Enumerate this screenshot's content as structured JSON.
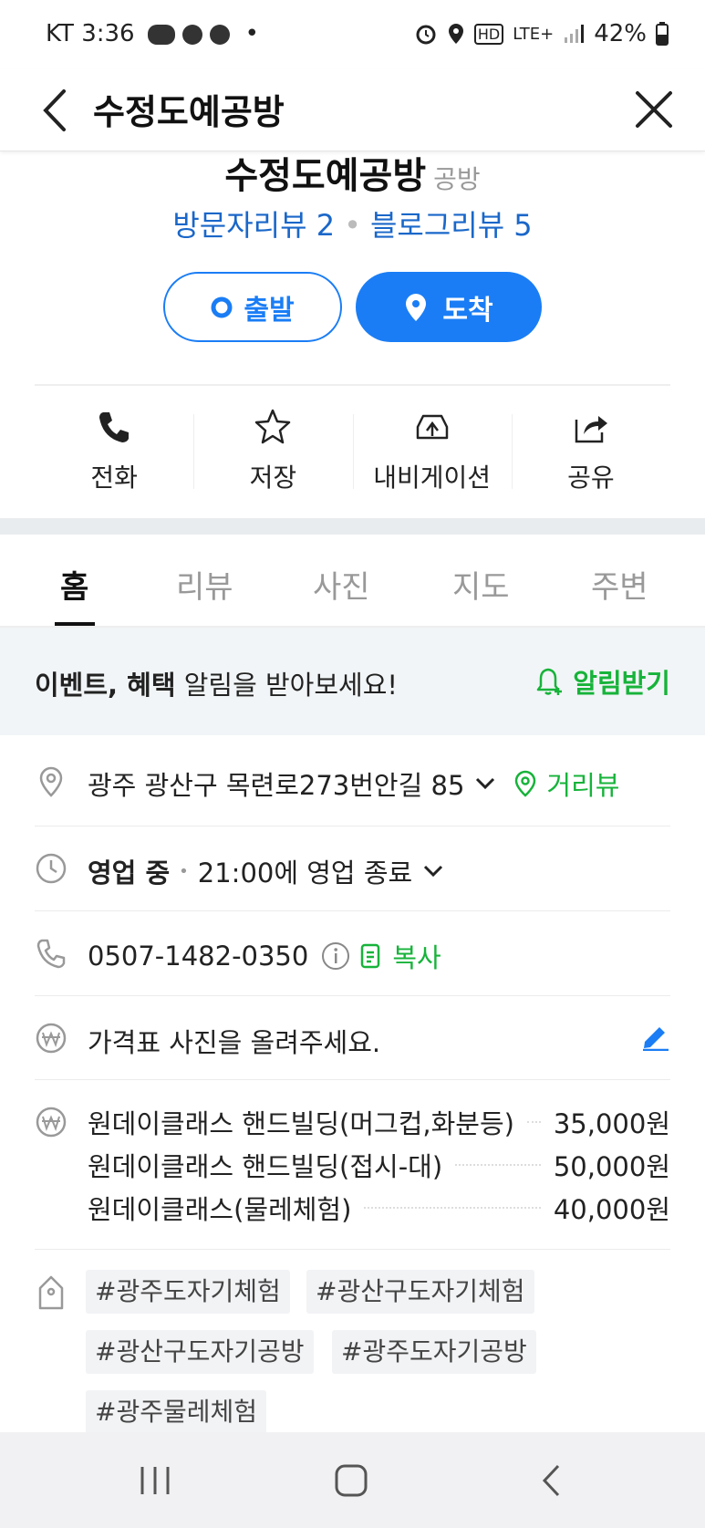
{
  "status": {
    "carrier": "KT",
    "time": "3:36",
    "battery": "42%",
    "network": "LTE+"
  },
  "appbar": {
    "title": "수정도예공방"
  },
  "place": {
    "name": "수정도예공방",
    "category": "공방",
    "visitor_reviews": "방문자리뷰 2",
    "blog_reviews": "블로그리뷰 5"
  },
  "route": {
    "depart_label": "출발",
    "arrive_label": "도착"
  },
  "actions": [
    {
      "label": "전화",
      "icon": "phone-icon"
    },
    {
      "label": "저장",
      "icon": "star-icon"
    },
    {
      "label": "내비게이션",
      "icon": "car-navigation-icon"
    },
    {
      "label": "공유",
      "icon": "share-icon"
    }
  ],
  "tabs": [
    "홈",
    "리뷰",
    "사진",
    "지도",
    "주변"
  ],
  "event": {
    "bold": "이벤트, 혜택",
    "rest": " 알림을 받아보세요!",
    "action": "알림받기"
  },
  "address": {
    "text": "광주 광산구 목련로273번안길 85",
    "streetview": "거리뷰"
  },
  "hours": {
    "status": "영업 중",
    "close": "21:00에 영업 종료"
  },
  "phone": {
    "number": "0507-1482-0350",
    "copy": "복사"
  },
  "price_prompt": "가격표 사진을 올려주세요.",
  "prices": [
    {
      "name": "원데이클래스 핸드빌딩(머그컵,화분등)",
      "price": "35,000원"
    },
    {
      "name": "원데이클래스 핸드빌딩(접시-대)",
      "price": "50,000원"
    },
    {
      "name": "원데이클래스(물레체험)",
      "price": "40,000원"
    }
  ],
  "tags": [
    "#광주도자기체험",
    "#광산구도자기체험",
    "#광산구도자기공방",
    "#광주도자기공방",
    "#광주물레체험"
  ],
  "colors": {
    "accent": "#1a7df5",
    "green": "#17b33a",
    "link": "#1a67c9"
  }
}
